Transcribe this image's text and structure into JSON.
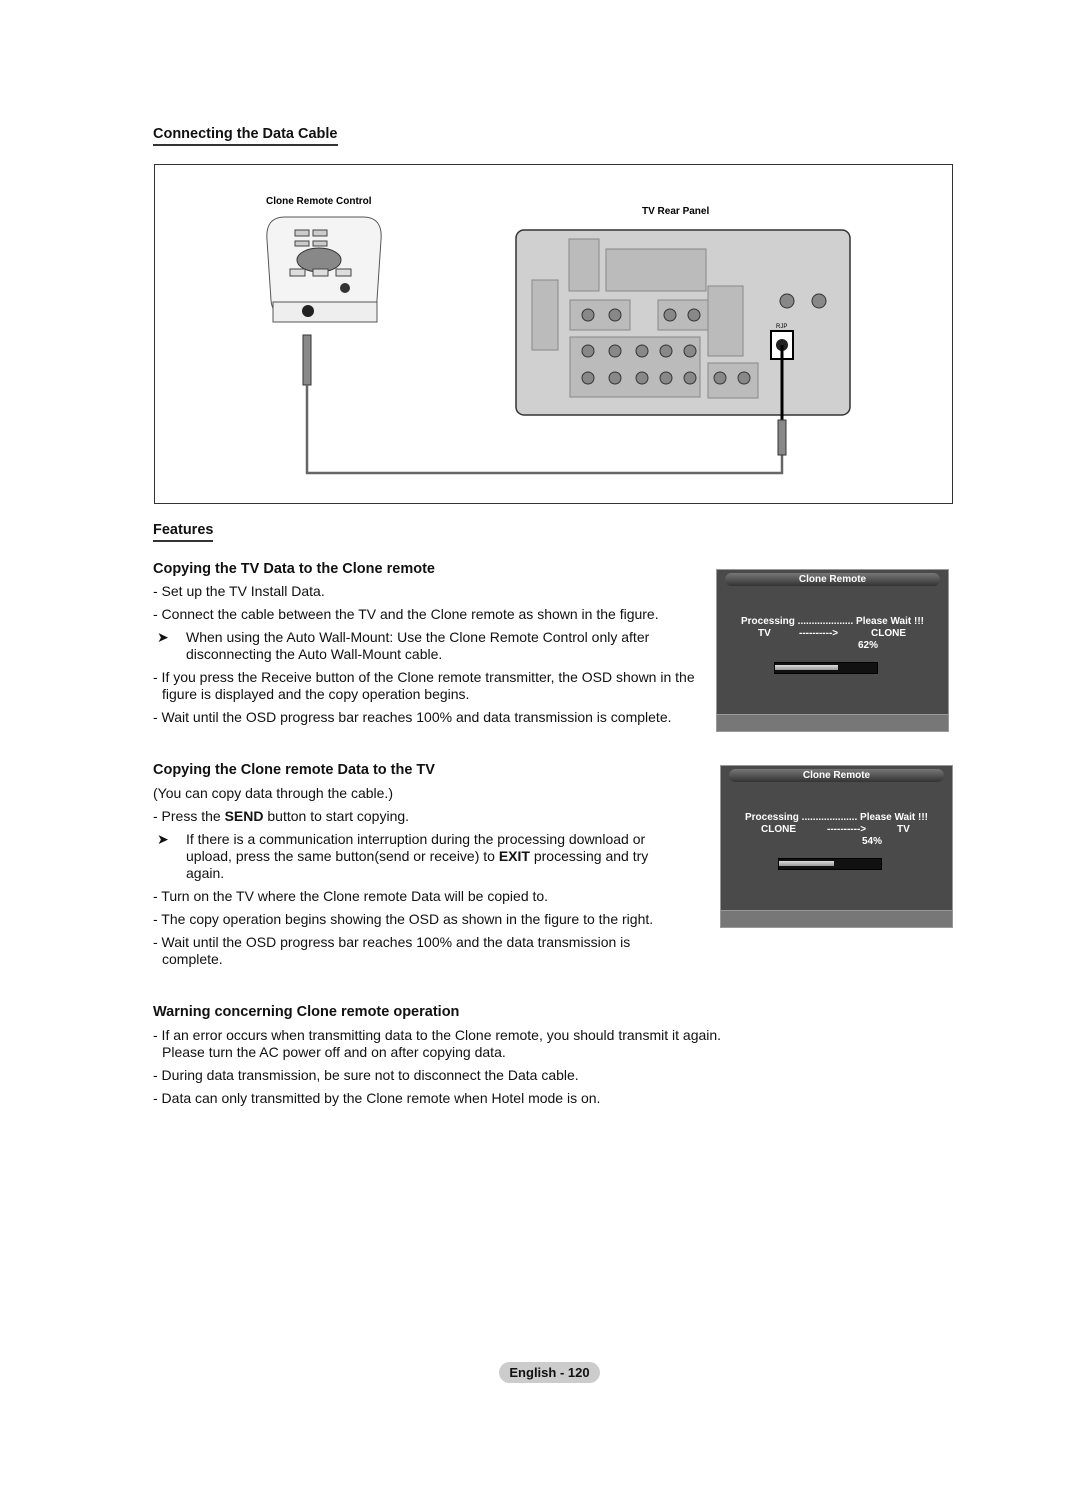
{
  "section1": {
    "heading": "Connecting the Data Cable",
    "diagram": {
      "remote_label": "Clone Remote Control",
      "tv_label": "TV Rear Panel",
      "port_label": "RJP"
    }
  },
  "features": {
    "heading": "Features",
    "copy_tv": {
      "heading": "Copying the TV Data to the Clone remote",
      "items": [
        "- Set up the TV Install Data.",
        "- Connect the cable between the TV and the Clone remote as shown in the figure."
      ],
      "note": "When using the Auto Wall-Mount: Use the Clone Remote Control only after disconnecting the Auto Wall-Mount cable.",
      "items2": [
        "- If you press the Receive button of the Clone remote transmitter, the OSD shown in the figure is displayed and the copy operation begins.",
        "- Wait until the OSD progress bar reaches 100% and data transmission is complete."
      ]
    },
    "copy_clone": {
      "heading": "Copying the Clone remote Data to the TV",
      "intro": "(You can copy data through the cable.)",
      "item_pre": "- Press the ",
      "item_bold": "SEND",
      "item_post": " button to start copying.",
      "note_pre": "If there is a communication interruption during the processing download or upload, press the same button(send or receive) to ",
      "note_bold": "EXIT",
      "note_post": " processing and try again.",
      "items2": [
        "- Turn on the TV where the Clone remote Data will be copied to.",
        "- The copy operation begins showing the OSD as shown in the figure to the right.",
        "- Wait until the OSD progress bar reaches 100% and the data transmission is complete."
      ]
    },
    "warning": {
      "heading": "Warning concerning Clone remote operation",
      "items": [
        "- If an error occurs when transmitting data to the Clone remote, you should transmit it again. Please turn the AC power off and on after copying data.",
        "- During data transmission, be sure not to disconnect the Data cable.",
        "- Data can only transmitted by the Clone remote when Hotel mode is on."
      ]
    }
  },
  "note_icon": "arrow-right",
  "osd1": {
    "title": "Clone Remote",
    "processing": "Processing .................... Please Wait !!!",
    "from": "TV",
    "arrow": "---------->",
    "to": "CLONE",
    "percent": "62%",
    "progress": 62
  },
  "osd2": {
    "title": "Clone Remote",
    "processing": "Processing .................... Please Wait !!!",
    "from": "CLONE",
    "arrow": "---------->",
    "to": "TV",
    "percent": "54%",
    "progress": 54
  },
  "footer": {
    "label": "English - 120"
  }
}
